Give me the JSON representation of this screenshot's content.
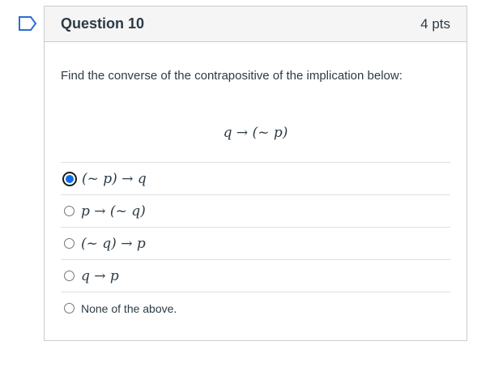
{
  "question": {
    "title": "Question 10",
    "points": "4 pts",
    "prompt": "Find the converse of the contrapositive of the implication below:",
    "formula": "q → (~ p)"
  },
  "answers": [
    {
      "label": "(~ p) → q",
      "selected": true
    },
    {
      "label": "p → (~ q)",
      "selected": false
    },
    {
      "label": "(~ q) → p",
      "selected": false
    },
    {
      "label": "q → p",
      "selected": false
    },
    {
      "label": "None of the above.",
      "selected": false
    }
  ],
  "icons": {
    "flag": "flag-icon"
  },
  "colors": {
    "selected_radio": "#0a6fe8",
    "header_bg": "#f5f5f5",
    "border": "#c7cdd1"
  }
}
